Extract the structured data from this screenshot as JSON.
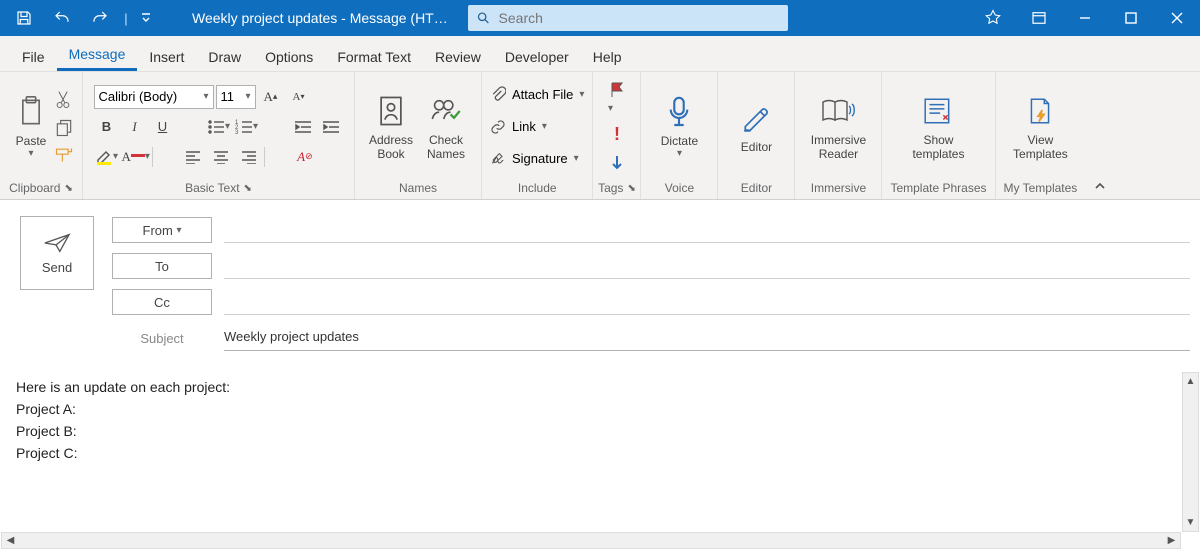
{
  "titlebar": {
    "title": "Weekly project updates - Message (HT…",
    "search_placeholder": "Search"
  },
  "tabs": [
    "File",
    "Message",
    "Insert",
    "Draw",
    "Options",
    "Format Text",
    "Review",
    "Developer",
    "Help"
  ],
  "active_tab": "Message",
  "ribbon": {
    "clipboard": {
      "paste": "Paste",
      "label": "Clipboard"
    },
    "basictext": {
      "font": "Calibri (Body)",
      "size": "11",
      "label": "Basic Text"
    },
    "names": {
      "addressbook": "Address\nBook",
      "checknames": "Check\nNames",
      "label": "Names"
    },
    "include": {
      "attach": "Attach File",
      "link": "Link",
      "signature": "Signature",
      "label": "Include"
    },
    "tags": {
      "label": "Tags"
    },
    "voice": {
      "dictate": "Dictate",
      "label": "Voice"
    },
    "editor": {
      "editor": "Editor",
      "label": "Editor"
    },
    "immersive": {
      "reader": "Immersive\nReader",
      "label": "Immersive"
    },
    "templatephrases": {
      "show": "Show\ntemplates",
      "label": "Template Phrases"
    },
    "mytemplates": {
      "view": "View\nTemplates",
      "label": "My Templates"
    }
  },
  "addr": {
    "send": "Send",
    "from": "From",
    "to": "To",
    "cc": "Cc",
    "subject_lbl": "Subject",
    "subject": "Weekly project updates"
  },
  "body_lines": [
    "Here is an update on each project:",
    "",
    "Project A:",
    "Project B:",
    "Project C:"
  ]
}
